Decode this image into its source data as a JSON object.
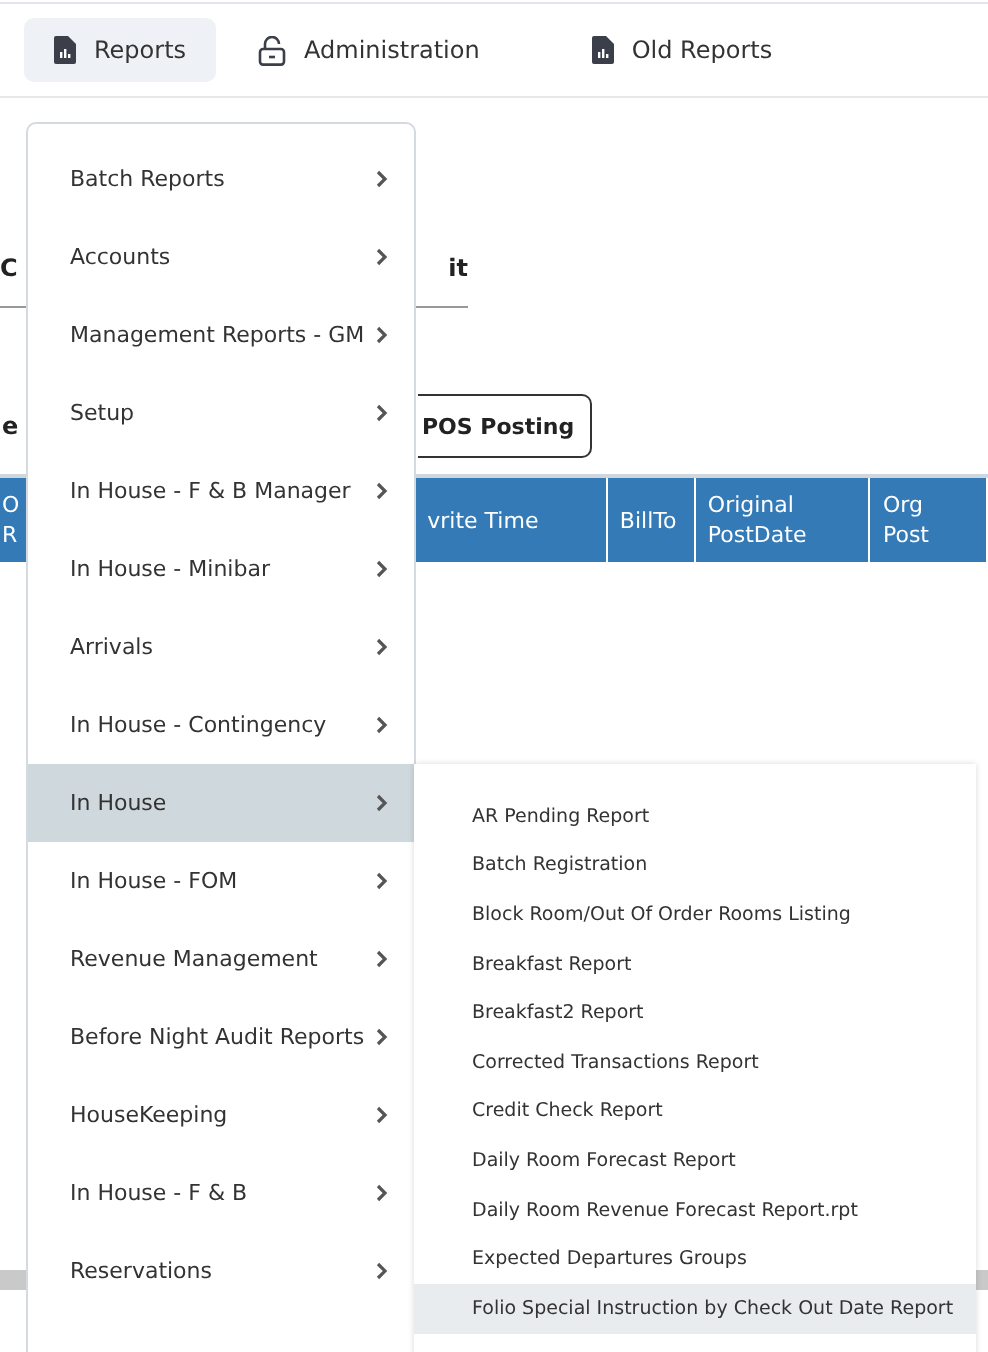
{
  "nav_tabs": [
    {
      "label": "Reports",
      "kind": "report",
      "selected": true
    },
    {
      "label": "Administration",
      "kind": "lock",
      "selected": false
    },
    {
      "label": "Old Reports",
      "kind": "report",
      "selected": false
    }
  ],
  "page": {
    "tab_left": "C",
    "tab_right": "it",
    "button_left": "e",
    "pos_button": "POS Posting",
    "table_columns": [
      "O\nR",
      "vrite Time",
      "BillTo",
      "Original\nPostDate",
      "Org Post"
    ]
  },
  "menu": {
    "items": [
      {
        "label": "Batch Reports",
        "selected": false
      },
      {
        "label": "Accounts",
        "selected": false
      },
      {
        "label": "Management Reports - GM",
        "selected": false
      },
      {
        "label": "Setup",
        "selected": false
      },
      {
        "label": "In House - F & B Manager",
        "selected": false
      },
      {
        "label": "In House - Minibar",
        "selected": false
      },
      {
        "label": "Arrivals",
        "selected": false
      },
      {
        "label": "In House - Contingency",
        "selected": false
      },
      {
        "label": "In House",
        "selected": true
      },
      {
        "label": "In House - FOM",
        "selected": false
      },
      {
        "label": "Revenue Management",
        "selected": false
      },
      {
        "label": "Before Night Audit Reports",
        "selected": false
      },
      {
        "label": "HouseKeeping",
        "selected": false
      },
      {
        "label": "In House - F & B",
        "selected": false
      },
      {
        "label": "Reservations",
        "selected": false
      }
    ]
  },
  "submenu": {
    "items": [
      {
        "label": "AR Pending Report",
        "selected": false
      },
      {
        "label": "Batch Registration",
        "selected": false
      },
      {
        "label": "Block Room/Out Of Order Rooms Listing",
        "selected": false
      },
      {
        "label": "Breakfast Report",
        "selected": false
      },
      {
        "label": "Breakfast2 Report",
        "selected": false
      },
      {
        "label": "Corrected Transactions Report",
        "selected": false
      },
      {
        "label": "Credit Check Report",
        "selected": false
      },
      {
        "label": "Daily Room Forecast Report",
        "selected": false
      },
      {
        "label": "Daily Room Revenue Forecast Report.rpt",
        "selected": false
      },
      {
        "label": "Expected Departures Groups",
        "selected": false
      },
      {
        "label": "Folio Special Instruction by Check Out Date Report",
        "selected": true
      }
    ]
  }
}
